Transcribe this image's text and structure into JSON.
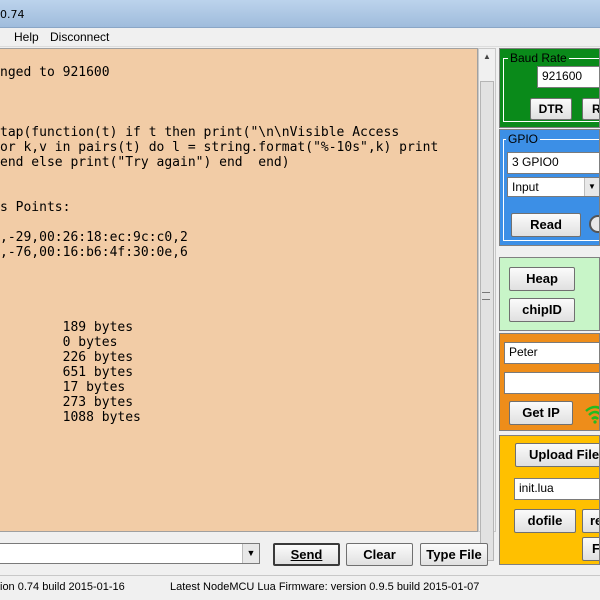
{
  "window": {
    "title": "0.74"
  },
  "menu": {
    "items": [
      "Help",
      "Disconnect"
    ]
  },
  "terminal": {
    "lines": [
      "nged to 921600",
      "",
      "",
      "",
      "tap(function(t) if t then print(\"\\n\\nVisible Access",
      "or k,v in pairs(t) do l = string.format(\"%-10s\",k) print",
      "end else print(\"Try again\") end  end)",
      "",
      "",
      "s Points:",
      "",
      ",-29,00:26:18:ec:9c:c0,2",
      ",-76,00:16:b6:4f:30:0e,6",
      "",
      "",
      "",
      "",
      "        189 bytes",
      "        0 bytes",
      "        226 bytes",
      "        651 bytes",
      "        17 bytes",
      "        273 bytes",
      "        1088 bytes"
    ]
  },
  "command": {
    "value": ""
  },
  "buttons": {
    "send": "Send",
    "clear": "Clear",
    "type_file": "Type File"
  },
  "status": {
    "version": "ion 0.74  build 2015-01-16",
    "firmware": "Latest NodeMCU Lua Firmware:  version 0.9.5 build 2015-01-07"
  },
  "baud": {
    "label": "Baud Rate",
    "value": "921600",
    "dtr": "DTR",
    "rts": "R"
  },
  "gpio": {
    "label": "GPIO",
    "pin": "3 GPIO0",
    "mode": "Input",
    "read": "Read"
  },
  "heap": {
    "heap": "Heap",
    "chipid": "chipID"
  },
  "wifi": {
    "ssid": "Peter",
    "password": "",
    "get_ip": "Get IP"
  },
  "file": {
    "upload": "Upload File.",
    "filename": "init.lua",
    "dofile": "dofile",
    "re": "re",
    "f": "F"
  },
  "colors": {
    "terminal_bg": "#f2cca6",
    "baud_panel": "#0a8a1a",
    "gpio_panel": "#3c8fe6",
    "heap_panel": "#c8f5c8",
    "wifi_panel": "#ee8d1a",
    "file_panel": "#ffc000"
  }
}
